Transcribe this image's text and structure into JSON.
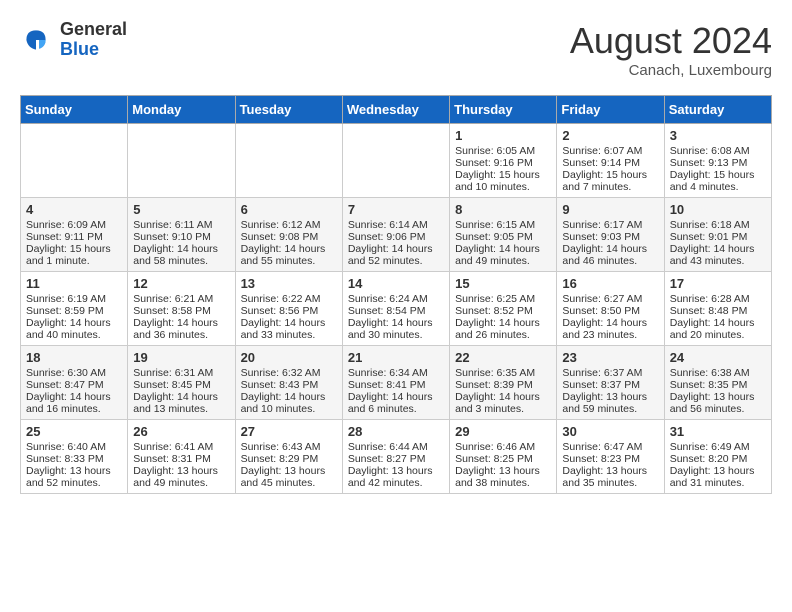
{
  "header": {
    "logo_general": "General",
    "logo_blue": "Blue",
    "month_year": "August 2024",
    "location": "Canach, Luxembourg"
  },
  "days_of_week": [
    "Sunday",
    "Monday",
    "Tuesday",
    "Wednesday",
    "Thursday",
    "Friday",
    "Saturday"
  ],
  "weeks": [
    [
      {
        "day": "",
        "info": ""
      },
      {
        "day": "",
        "info": ""
      },
      {
        "day": "",
        "info": ""
      },
      {
        "day": "",
        "info": ""
      },
      {
        "day": "1",
        "info": "Sunrise: 6:05 AM\nSunset: 9:16 PM\nDaylight: 15 hours\nand 10 minutes."
      },
      {
        "day": "2",
        "info": "Sunrise: 6:07 AM\nSunset: 9:14 PM\nDaylight: 15 hours\nand 7 minutes."
      },
      {
        "day": "3",
        "info": "Sunrise: 6:08 AM\nSunset: 9:13 PM\nDaylight: 15 hours\nand 4 minutes."
      }
    ],
    [
      {
        "day": "4",
        "info": "Sunrise: 6:09 AM\nSunset: 9:11 PM\nDaylight: 15 hours\nand 1 minute."
      },
      {
        "day": "5",
        "info": "Sunrise: 6:11 AM\nSunset: 9:10 PM\nDaylight: 14 hours\nand 58 minutes."
      },
      {
        "day": "6",
        "info": "Sunrise: 6:12 AM\nSunset: 9:08 PM\nDaylight: 14 hours\nand 55 minutes."
      },
      {
        "day": "7",
        "info": "Sunrise: 6:14 AM\nSunset: 9:06 PM\nDaylight: 14 hours\nand 52 minutes."
      },
      {
        "day": "8",
        "info": "Sunrise: 6:15 AM\nSunset: 9:05 PM\nDaylight: 14 hours\nand 49 minutes."
      },
      {
        "day": "9",
        "info": "Sunrise: 6:17 AM\nSunset: 9:03 PM\nDaylight: 14 hours\nand 46 minutes."
      },
      {
        "day": "10",
        "info": "Sunrise: 6:18 AM\nSunset: 9:01 PM\nDaylight: 14 hours\nand 43 minutes."
      }
    ],
    [
      {
        "day": "11",
        "info": "Sunrise: 6:19 AM\nSunset: 8:59 PM\nDaylight: 14 hours\nand 40 minutes."
      },
      {
        "day": "12",
        "info": "Sunrise: 6:21 AM\nSunset: 8:58 PM\nDaylight: 14 hours\nand 36 minutes."
      },
      {
        "day": "13",
        "info": "Sunrise: 6:22 AM\nSunset: 8:56 PM\nDaylight: 14 hours\nand 33 minutes."
      },
      {
        "day": "14",
        "info": "Sunrise: 6:24 AM\nSunset: 8:54 PM\nDaylight: 14 hours\nand 30 minutes."
      },
      {
        "day": "15",
        "info": "Sunrise: 6:25 AM\nSunset: 8:52 PM\nDaylight: 14 hours\nand 26 minutes."
      },
      {
        "day": "16",
        "info": "Sunrise: 6:27 AM\nSunset: 8:50 PM\nDaylight: 14 hours\nand 23 minutes."
      },
      {
        "day": "17",
        "info": "Sunrise: 6:28 AM\nSunset: 8:48 PM\nDaylight: 14 hours\nand 20 minutes."
      }
    ],
    [
      {
        "day": "18",
        "info": "Sunrise: 6:30 AM\nSunset: 8:47 PM\nDaylight: 14 hours\nand 16 minutes."
      },
      {
        "day": "19",
        "info": "Sunrise: 6:31 AM\nSunset: 8:45 PM\nDaylight: 14 hours\nand 13 minutes."
      },
      {
        "day": "20",
        "info": "Sunrise: 6:32 AM\nSunset: 8:43 PM\nDaylight: 14 hours\nand 10 minutes."
      },
      {
        "day": "21",
        "info": "Sunrise: 6:34 AM\nSunset: 8:41 PM\nDaylight: 14 hours\nand 6 minutes."
      },
      {
        "day": "22",
        "info": "Sunrise: 6:35 AM\nSunset: 8:39 PM\nDaylight: 14 hours\nand 3 minutes."
      },
      {
        "day": "23",
        "info": "Sunrise: 6:37 AM\nSunset: 8:37 PM\nDaylight: 13 hours\nand 59 minutes."
      },
      {
        "day": "24",
        "info": "Sunrise: 6:38 AM\nSunset: 8:35 PM\nDaylight: 13 hours\nand 56 minutes."
      }
    ],
    [
      {
        "day": "25",
        "info": "Sunrise: 6:40 AM\nSunset: 8:33 PM\nDaylight: 13 hours\nand 52 minutes."
      },
      {
        "day": "26",
        "info": "Sunrise: 6:41 AM\nSunset: 8:31 PM\nDaylight: 13 hours\nand 49 minutes."
      },
      {
        "day": "27",
        "info": "Sunrise: 6:43 AM\nSunset: 8:29 PM\nDaylight: 13 hours\nand 45 minutes."
      },
      {
        "day": "28",
        "info": "Sunrise: 6:44 AM\nSunset: 8:27 PM\nDaylight: 13 hours\nand 42 minutes."
      },
      {
        "day": "29",
        "info": "Sunrise: 6:46 AM\nSunset: 8:25 PM\nDaylight: 13 hours\nand 38 minutes."
      },
      {
        "day": "30",
        "info": "Sunrise: 6:47 AM\nSunset: 8:23 PM\nDaylight: 13 hours\nand 35 minutes."
      },
      {
        "day": "31",
        "info": "Sunrise: 6:49 AM\nSunset: 8:20 PM\nDaylight: 13 hours\nand 31 minutes."
      }
    ]
  ]
}
